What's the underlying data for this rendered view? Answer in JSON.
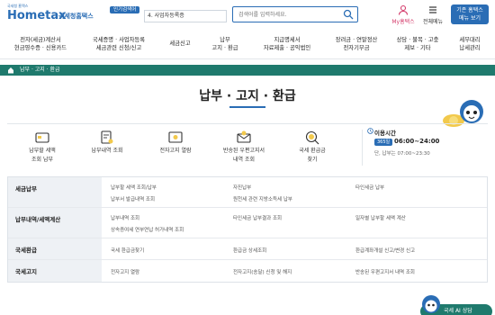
{
  "header": {
    "logo_sub": "국세청 홈택스",
    "logo_main": "Hometax",
    "logo_kr": "국세청홈택스",
    "popular_badge": "인기검색어",
    "popular_item": "4. 사업자등록증",
    "search_placeholder": "검색어를 입력하세요.",
    "my_hometax": "My홈택스",
    "all_menu": "전체메뉴",
    "basic_menu_line1": "기존 홈택스",
    "basic_menu_line2": "메뉴 보기"
  },
  "gnb": [
    {
      "line1": "전자(세금)계산서",
      "line2": "현금영수증 · 신용카드"
    },
    {
      "line1": "국세증명 · 사업자등록",
      "line2": "세금관련 신청/신고"
    },
    {
      "line1": "세금신고",
      "line2": ""
    },
    {
      "line1": "납부",
      "line2": "고지 · 환급"
    },
    {
      "line1": "지급명세서",
      "line2": "자료제출 · 공익법인"
    },
    {
      "line1": "장려금 · 연말정산",
      "line2": "전자기부금"
    },
    {
      "line1": "상담 · 불복 · 고충",
      "line2": "제보 · 기타"
    },
    {
      "line1": "세무대리",
      "line2": "납세관리"
    }
  ],
  "breadcrumb": "납부 · 고지 · 환급",
  "page_title": "납부 · 고지 · 환급",
  "quick_items": [
    {
      "label1": "납부할 세액",
      "label2": "조회 납부",
      "icon": "card-icon"
    },
    {
      "label1": "납부내역 조회",
      "label2": "",
      "icon": "receipt-search-icon"
    },
    {
      "label1": "전자고지 열람",
      "label2": "",
      "icon": "document-view-icon"
    },
    {
      "label1": "반송된 우편고지서",
      "label2": "내역 조회",
      "icon": "mail-return-icon"
    },
    {
      "label1": "국세 환급금",
      "label2": "찾기",
      "icon": "refund-search-icon"
    }
  ],
  "hours": {
    "title": "이용시간",
    "badge": "365일",
    "time": "06:00~24:00",
    "note": "단, 납부는 07:00~23:30"
  },
  "categories": [
    {
      "name": "세금납부",
      "links": [
        [
          "납부할 세액 조회/납부",
          "자진납부",
          "타인세금 납부"
        ],
        [
          "납부서 발급내역 조회",
          "원천세 관련 지방소득세 납부",
          ""
        ]
      ]
    },
    {
      "name": "납부내역/세액계산",
      "links": [
        [
          "납부내역 조회",
          "타인세금 납부결과 조회",
          "일자별 납부할 세액 계산"
        ],
        [
          "상속증여세 연부연납 허가내역 조회",
          "",
          ""
        ]
      ]
    },
    {
      "name": "국세환급",
      "links": [
        [
          "국세 환급금찾기",
          "환급금 상세조회",
          "환급계좌개설 신고/변경 신고"
        ]
      ]
    },
    {
      "name": "국세고지",
      "links": [
        [
          "전자고지 열람",
          "전자고지(송달) 신청 및 해지",
          "반송된 우편고지서 내역 조회"
        ]
      ]
    }
  ],
  "chat_label": "국세 AI 상담",
  "colors": {
    "brand_blue": "#2a6db5",
    "breadcrumb_green": "#1f7a6d",
    "my_hometax_pink": "#d43b6b"
  }
}
